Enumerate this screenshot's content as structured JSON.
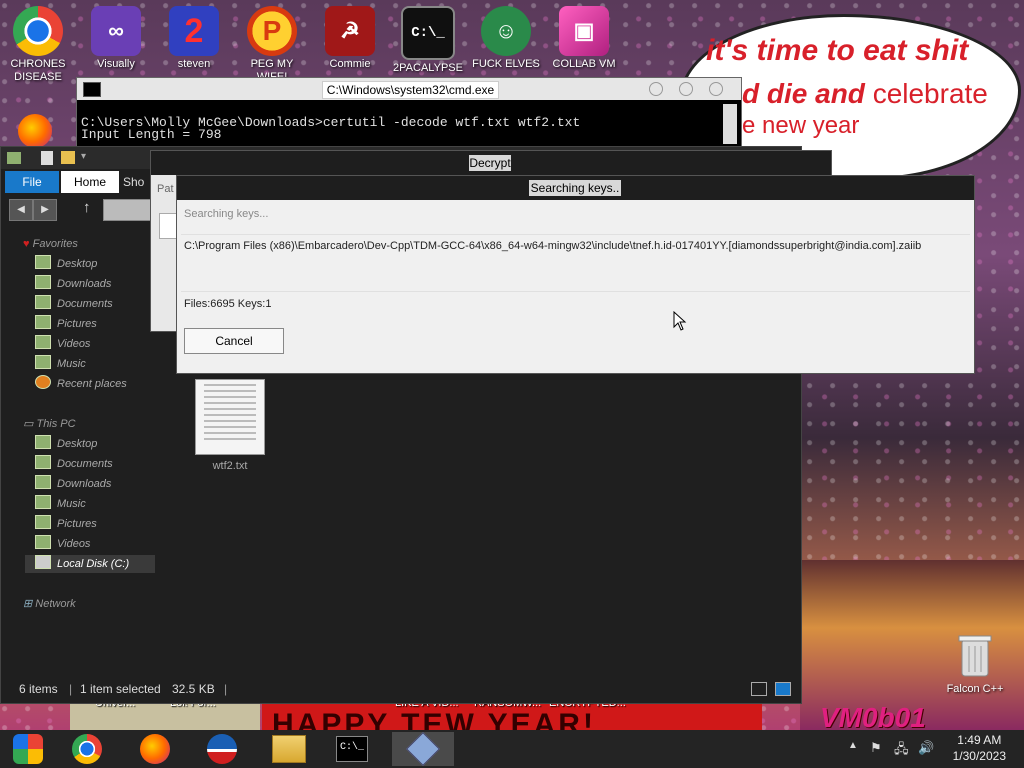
{
  "desktop": {
    "icons": [
      {
        "label": "CHRONES DISEASE",
        "icon": "chrome-icon",
        "color": "#2b7de9"
      },
      {
        "label": "Visually",
        "icon": "visual-studio-icon",
        "color": "#6a3fb5"
      },
      {
        "label": "steven",
        "icon": "steven-icon",
        "color": "#c02020"
      },
      {
        "label": "PEG MY WIFE!",
        "icon": "peg-icon",
        "color": "#d83a10"
      },
      {
        "label": "Commie",
        "icon": "commie-icon",
        "color": "#a01818"
      },
      {
        "label": "2PACALYPSE",
        "icon": "terminal-icon",
        "color": "#101010"
      },
      {
        "label": "FUCK ELVES",
        "icon": "elf-icon",
        "color": "#2a8a4a"
      },
      {
        "label": "COLLAB VM",
        "icon": "collabvm-icon",
        "color": "#b02080"
      }
    ],
    "wallpaper_text": {
      "line1": "it's time to eat shit",
      "line2": "d die and",
      "line2_sub": "celebrate",
      "line3": "e new year"
    },
    "banner_text": "HAPPY TEW YEAR!",
    "strip_labels": [
      "Univer...",
      "Lol! For...",
      "LIKE A VID...",
      "RANSOMW...",
      "ENCRYPTED..."
    ],
    "vm_logo": "VM0b01",
    "recycle_bin_label": "Falcon C++"
  },
  "cmd": {
    "title": "C:\\Windows\\system32\\cmd.exe",
    "lines": [
      "C:\\Users\\Molly McGee\\Downloads>certutil -decode wtf.txt wtf2.txt",
      "Input Length = 798"
    ]
  },
  "explorer": {
    "tabs": [
      "File",
      "Home",
      "Sho"
    ],
    "favorites_label": "Favorites",
    "favorites": [
      "Desktop",
      "Downloads",
      "Documents",
      "Pictures",
      "Videos",
      "Music",
      "Recent places"
    ],
    "this_pc_label": "This PC",
    "this_pc": [
      "Desktop",
      "Documents",
      "Downloads",
      "Music",
      "Pictures",
      "Videos",
      "Local Disk (C:)"
    ],
    "network_label": "Network",
    "file_name": "wtf2.txt",
    "status": {
      "items": "6 items",
      "selected": "1 item selected",
      "size": "32.5 KB"
    }
  },
  "decrypt": {
    "title": "Decrypt",
    "path_label": "Pat"
  },
  "progress": {
    "title": "Searching keys..",
    "status": "Searching keys...",
    "current_path": "C:\\Program Files (x86)\\Embarcadero\\Dev-Cpp\\TDM-GCC-64\\x86_64-w64-mingw32\\include\\tnef.h.id-017401YY.[diamondssuperbright@india.com].zaiib",
    "counts": "Files:6695 Keys:1",
    "cancel_label": "Cancel"
  },
  "taskbar": {
    "apps": [
      "start-button-icon",
      "chrome-icon",
      "firefox-icon",
      "obama-icon",
      "file-explorer-icon",
      "cmd-icon",
      "decrypt-app-icon"
    ],
    "time": "1:49 AM",
    "date": "1/30/2023"
  },
  "colors": {
    "accent": "#1979ca",
    "window_dark": "#1f1f1f",
    "banner_red": "#d01818",
    "speech_red": "#d8202a"
  }
}
